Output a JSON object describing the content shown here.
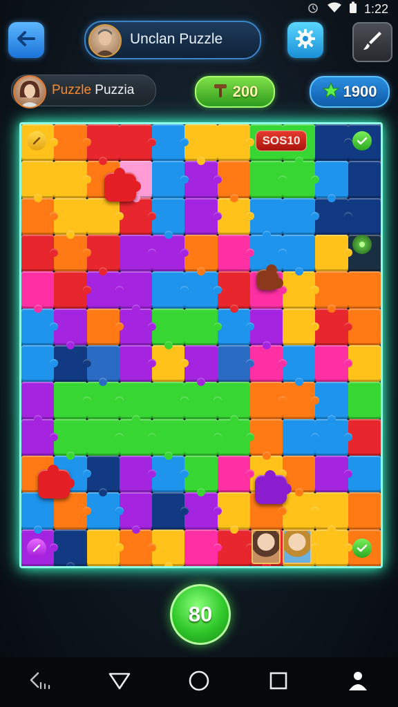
{
  "status_bar": {
    "time": "1:22"
  },
  "header": {
    "title": "Unclan Puzzle"
  },
  "player": {
    "name_part1": "Puzzle",
    "name_part2": " Puzzia"
  },
  "currency": {
    "coins": "200",
    "stars": "1900"
  },
  "board": {
    "score_tag": "SOS10",
    "colors": {
      "R": "#e8262e",
      "O": "#ff7a14",
      "Y": "#ffc21a",
      "G": "#38d632",
      "B": "#1e94ec",
      "P": "#a524e0",
      "M": "#ff2fa4",
      "N": "#123a82",
      "D": "#1a2f42",
      "K": "#ff9cd6",
      "L": "#2a6cc4"
    },
    "rows": [
      "YORRBYYGGNN",
      "YYOKBPOGGBN",
      "OYYRBPYBBNN",
      "RORPPOMBBYD",
      "MRPPBBRMYOO",
      "BPOPGGBPYRO",
      "BNLPYPLMBMY",
      "PGGGGGGOOBG",
      "PGGGGGGOBBR",
      "OBNPBGMYOPB",
      "BOBPNPYOYYO",
      "PNYOYMRRYYO"
    ]
  },
  "moves": "80"
}
